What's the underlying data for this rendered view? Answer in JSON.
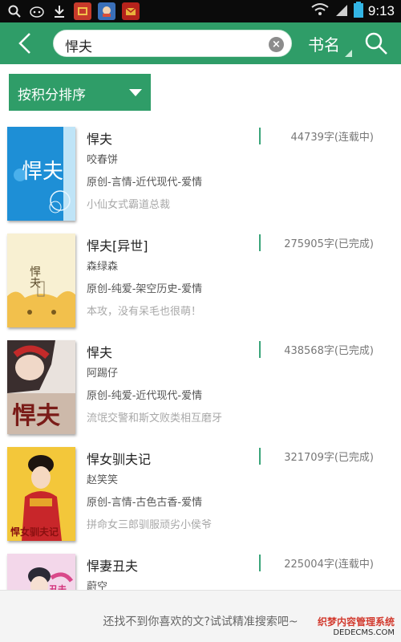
{
  "status_bar": {
    "time": "9:13"
  },
  "search": {
    "query": "悍夫",
    "type_label": "书名"
  },
  "sort": {
    "label": "按积分排序"
  },
  "books": [
    {
      "title": "悍夫",
      "author": "咬春饼",
      "tags": "原创-言情-近代现代-爱情",
      "intro": "小仙女式霸道总裁",
      "words": "44739字(连载中)"
    },
    {
      "title": "悍夫[异世]",
      "author": "森绿森",
      "tags": "原创-纯爱-架空历史-爱情",
      "intro": "本攻，没有呆毛也很萌！",
      "words": "275905字(已完成)"
    },
    {
      "title": "悍夫",
      "author": "阿踢仔",
      "tags": "原创-纯爱-近代现代-爱情",
      "intro": "流氓交警和斯文败类相互磨牙",
      "words": "438568字(已完成)"
    },
    {
      "title": "悍女驯夫记",
      "author": "赵笑笑",
      "tags": "原创-言情-古色古香-爱情",
      "intro": "拼命女三郎驯服顽劣小侯爷",
      "words": "321709字(已完成)"
    },
    {
      "title": "悍妻丑夫",
      "author": "蔚空",
      "tags": "",
      "intro": "",
      "words": "225004字(连载中)"
    }
  ],
  "covers": [
    {
      "text": "悍夫"
    },
    {
      "text": "悍夫"
    },
    {
      "text": "悍夫"
    },
    {
      "text": "悍女驯夫记"
    },
    {
      "text": "丑夫"
    }
  ],
  "bottom": {
    "hint": "还找不到你喜欢的文?试试精准搜索吧~"
  },
  "watermark": {
    "line1": "织梦内容管理系统",
    "line2": "DEDECMS.COM"
  },
  "colors": {
    "accent": "#2f9d68",
    "divider": "#3aa57a"
  }
}
